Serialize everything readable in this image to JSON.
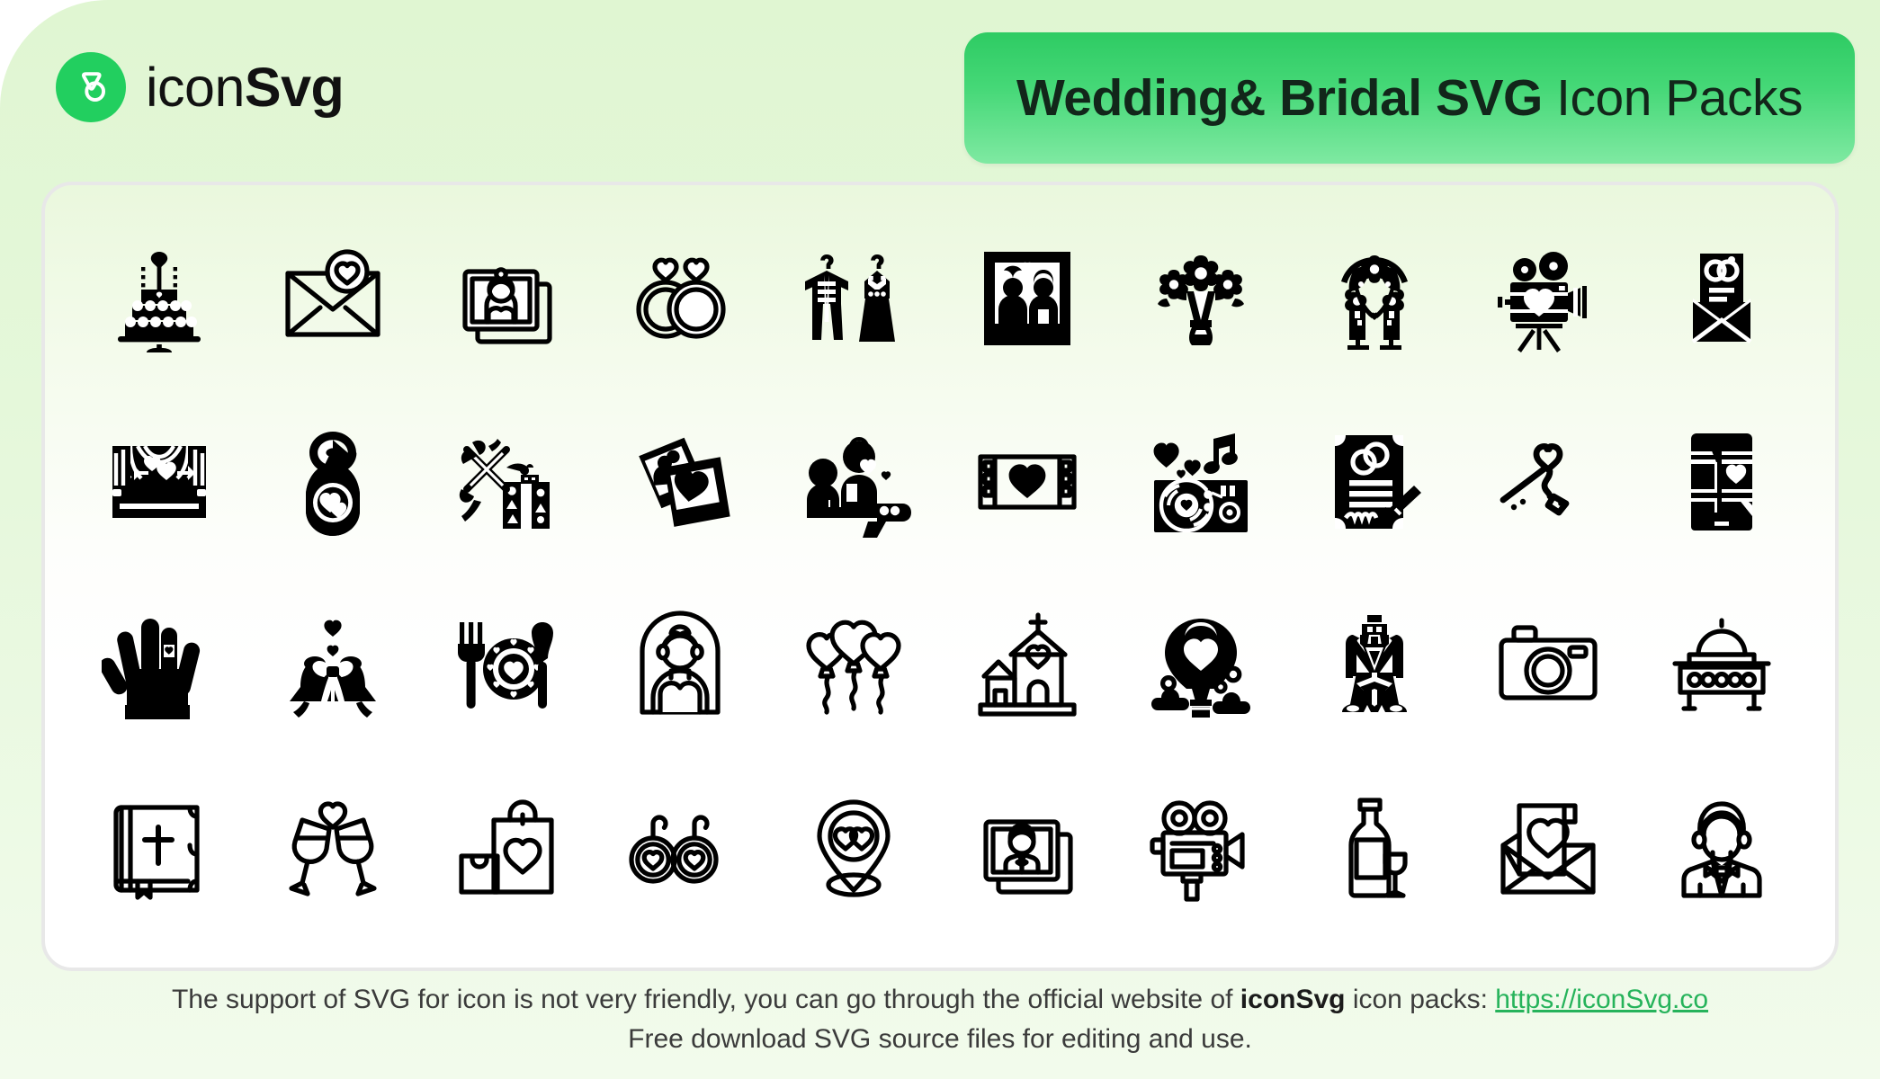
{
  "brand": {
    "logo_icon": "iconsvg-logo-icon",
    "name_light": "icon",
    "name_bold": "Svg",
    "logo_color": "#22cf5f"
  },
  "header": {
    "title_bold": "Wedding& Bridal SVG",
    "title_light": " Icon Packs",
    "banner_gradient_from": "#2ecb63",
    "banner_gradient_to": "#7fe9a2"
  },
  "icon_card": {
    "border_color": "#e8e8e8",
    "rows": 4,
    "columns": 10,
    "icons": [
      {
        "name": "wedding-cake-icon",
        "style": "filled"
      },
      {
        "name": "love-letter-envelope-icon",
        "style": "outline"
      },
      {
        "name": "bride-photo-frame-icon",
        "style": "outline"
      },
      {
        "name": "wedding-rings-icon",
        "style": "outline"
      },
      {
        "name": "suit-and-dress-hanger-icon",
        "style": "filled"
      },
      {
        "name": "couple-photo-frame-icon",
        "style": "filled"
      },
      {
        "name": "flower-bouquet-icon",
        "style": "filled"
      },
      {
        "name": "wedding-arch-icon",
        "style": "filled"
      },
      {
        "name": "wedding-video-camera-icon",
        "style": "filled"
      },
      {
        "name": "invitation-card-envelope-icon",
        "style": "filled"
      },
      {
        "name": "wedding-stage-curtain-icon",
        "style": "filled"
      },
      {
        "name": "door-hanger-heart-icon",
        "style": "filled"
      },
      {
        "name": "wedding-gift-box-icon",
        "style": "filled"
      },
      {
        "name": "polaroid-photos-icon",
        "style": "filled"
      },
      {
        "name": "marriage-proposal-icon",
        "style": "filled"
      },
      {
        "name": "film-strip-heart-icon",
        "style": "outline"
      },
      {
        "name": "wedding-dj-turntable-icon",
        "style": "filled"
      },
      {
        "name": "marriage-certificate-icon",
        "style": "filled"
      },
      {
        "name": "heart-key-tag-icon",
        "style": "outline"
      },
      {
        "name": "wedding-app-phone-icon",
        "style": "filled"
      },
      {
        "name": "hand-with-ring-icon",
        "style": "filled"
      },
      {
        "name": "wedding-bells-bow-icon",
        "style": "filled"
      },
      {
        "name": "wedding-dinner-setting-icon",
        "style": "filled"
      },
      {
        "name": "bride-veil-icon",
        "style": "outline"
      },
      {
        "name": "heart-balloons-icon",
        "style": "outline"
      },
      {
        "name": "wedding-church-icon",
        "style": "outline"
      },
      {
        "name": "hot-air-balloon-heart-icon",
        "style": "filled"
      },
      {
        "name": "groom-suit-icon",
        "style": "filled"
      },
      {
        "name": "wedding-photo-camera-icon",
        "style": "outline"
      },
      {
        "name": "catering-buffet-table-icon",
        "style": "outline"
      },
      {
        "name": "holy-bible-icon",
        "style": "outline"
      },
      {
        "name": "champagne-toast-heart-icon",
        "style": "outline"
      },
      {
        "name": "wedding-shopping-bags-icon",
        "style": "outline"
      },
      {
        "name": "heart-earrings-icon",
        "style": "outline"
      },
      {
        "name": "wedding-location-pin-icon",
        "style": "outline"
      },
      {
        "name": "groom-photo-frame-icon",
        "style": "outline"
      },
      {
        "name": "movie-camera-icon",
        "style": "outline"
      },
      {
        "name": "wine-bottle-glass-icon",
        "style": "outline"
      },
      {
        "name": "love-letter-card-icon",
        "style": "outline"
      },
      {
        "name": "groom-avatar-icon",
        "style": "outline"
      }
    ]
  },
  "footer": {
    "line1_part1": "The support of SVG for icon is not very friendly, you can go through the official website of ",
    "line1_brand": "iconSvg",
    "line1_part2": " icon packs: ",
    "line1_link": "https://iconSvg.co",
    "line2": "Free download SVG source files for editing and use.",
    "link_color": "#26b35b"
  }
}
